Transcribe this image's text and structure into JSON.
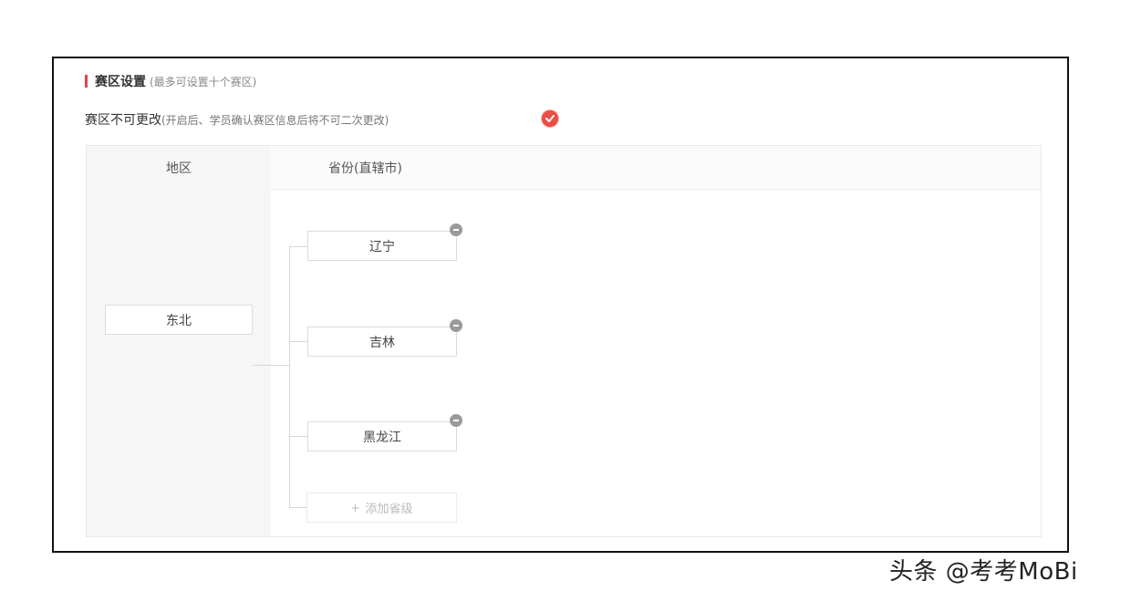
{
  "section": {
    "title": "赛区设置",
    "subtitle": "(最多可设置十个赛区)"
  },
  "option": {
    "label": "赛区不可更改",
    "note": "(开启后、学员确认赛区信息后将不可二次更改)",
    "checked": true,
    "accent_color": "#ea4e45"
  },
  "table": {
    "headers": {
      "region": "地区",
      "province": "省份(直辖市)"
    },
    "region": "东北",
    "provinces": [
      "辽宁",
      "吉林",
      "黑龙江"
    ],
    "add_label": "添加省级"
  },
  "icons": {
    "check": "check-circle-icon",
    "remove": "remove-circle-icon",
    "add": "plus-icon"
  },
  "watermark": "头条 @考考MoBi"
}
